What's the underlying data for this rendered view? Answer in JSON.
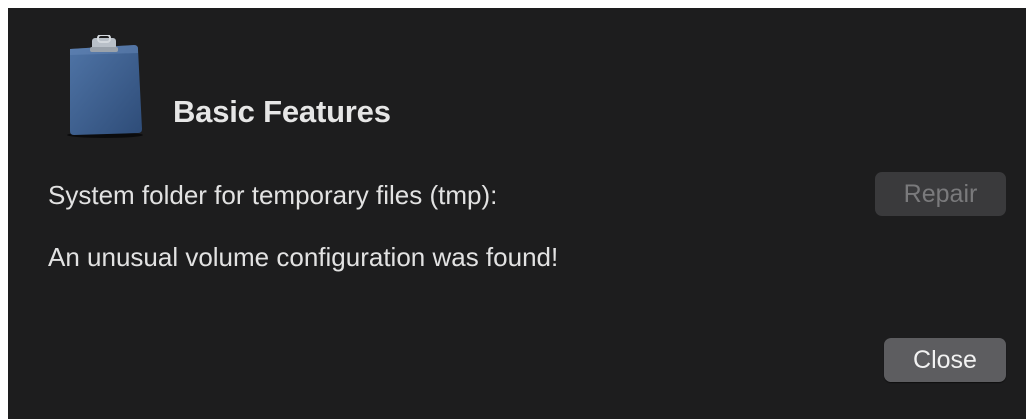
{
  "dialog": {
    "icon": "clipboard-icon",
    "title": "Basic Features",
    "tmp_folder_label": "System folder for temporary files (tmp):",
    "message": "An unusual volume configuration was found!",
    "repair_label": "Repair",
    "repair_enabled": false,
    "close_label": "Close"
  },
  "colors": {
    "background": "#1d1d1e",
    "text": "#e2e2e2",
    "icon_blue": "#3e5f8c"
  }
}
